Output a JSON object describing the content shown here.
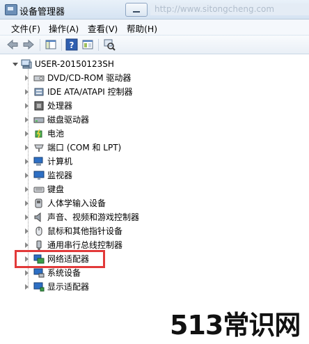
{
  "window": {
    "title": "设备管理器",
    "watermark_text": "http://www.sitongcheng.com"
  },
  "menu": [
    {
      "label": "文件(F)"
    },
    {
      "label": "操作(A)"
    },
    {
      "label": "查看(V)"
    },
    {
      "label": "帮助(H)"
    }
  ],
  "toolbar": {
    "buttons": [
      "back-icon",
      "forward-icon",
      "show-hide-tree-icon",
      "help-icon",
      "properties-icon",
      "scan-hardware-icon"
    ]
  },
  "tree": {
    "root": {
      "label": "USER-20150123SH",
      "icon": "computer-icon",
      "expanded": true
    },
    "items": [
      {
        "label": "DVD/CD-ROM 驱动器",
        "icon": "dvd-drive-icon"
      },
      {
        "label": "IDE ATA/ATAPI 控制器",
        "icon": "ide-controller-icon"
      },
      {
        "label": "处理器",
        "icon": "processor-icon"
      },
      {
        "label": "磁盘驱动器",
        "icon": "disk-drive-icon"
      },
      {
        "label": "电池",
        "icon": "battery-icon"
      },
      {
        "label": "端口 (COM 和 LPT)",
        "icon": "port-icon"
      },
      {
        "label": "计算机",
        "icon": "computer-icon"
      },
      {
        "label": "监视器",
        "icon": "monitor-icon"
      },
      {
        "label": "键盘",
        "icon": "keyboard-icon"
      },
      {
        "label": "人体学输入设备",
        "icon": "hid-icon"
      },
      {
        "label": "声音、视频和游戏控制器",
        "icon": "sound-icon"
      },
      {
        "label": "鼠标和其他指针设备",
        "icon": "mouse-icon"
      },
      {
        "label": "通用串行总线控制器",
        "icon": "usb-icon"
      },
      {
        "label": "网络适配器",
        "icon": "network-adapter-icon",
        "highlighted": true
      },
      {
        "label": "系统设备",
        "icon": "system-device-icon"
      },
      {
        "label": "显示适配器",
        "icon": "display-adapter-icon"
      }
    ]
  },
  "colors": {
    "highlight_border": "#e23a3a",
    "titlebar": "#dbe7f4"
  },
  "brand": {
    "text": "513常识网"
  }
}
